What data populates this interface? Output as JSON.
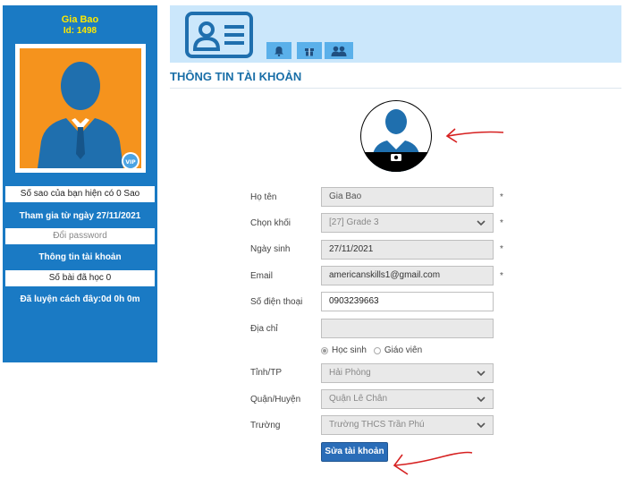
{
  "sidebar": {
    "name": "Gia Bao",
    "id": "Id: 1498",
    "stars_text": "Số sao của bạn hiện có 0 Sao",
    "joined_text": "Tham gia từ ngày 27/11/2021",
    "change_password": "Đổi password",
    "account_info": "Thông tin tài khoản",
    "lessons_text": "Số bài đã học 0",
    "practice_time": "Đã luyện cách đây:0d 0h 0m",
    "vip_label": "VIP"
  },
  "header": {
    "icons": [
      "id-card-icon",
      "bell-icon",
      "gift-icon",
      "users-icon"
    ]
  },
  "page": {
    "title": "THÔNG TIN TÀI KHOẢN"
  },
  "form": {
    "name_label": "Họ tên",
    "name_value": "Gia Bao",
    "grade_label": "Chọn khối",
    "grade_value": "[27] Grade 3",
    "dob_label": "Ngày sinh",
    "dob_value": "27/11/2021",
    "email_label": "Email",
    "email_value": "americanskills1@gmail.com",
    "phone_label": "Số điện thoại",
    "phone_value": "0903239663",
    "address_label": "Địa chỉ",
    "address_value": "",
    "role_student": "Học sinh",
    "role_teacher": "Giáo viên",
    "province_label": "Tỉnh/TP",
    "province_value": "Hải Phòng",
    "district_label": "Quận/Huyện",
    "district_value": "Quận Lê Chân",
    "school_label": "Trường",
    "school_value": "Trường THCS Trần Phú",
    "required_mark": "*",
    "submit_label": "Sửa tài khoản"
  },
  "colors": {
    "sidebar_bg": "#1a7ac4",
    "name_color": "#ffe800",
    "avatar_bg": "#f5931d",
    "header_bg": "#cbe7fb",
    "submit_bg": "#2a6db8",
    "annotation_red": "#d62020"
  }
}
